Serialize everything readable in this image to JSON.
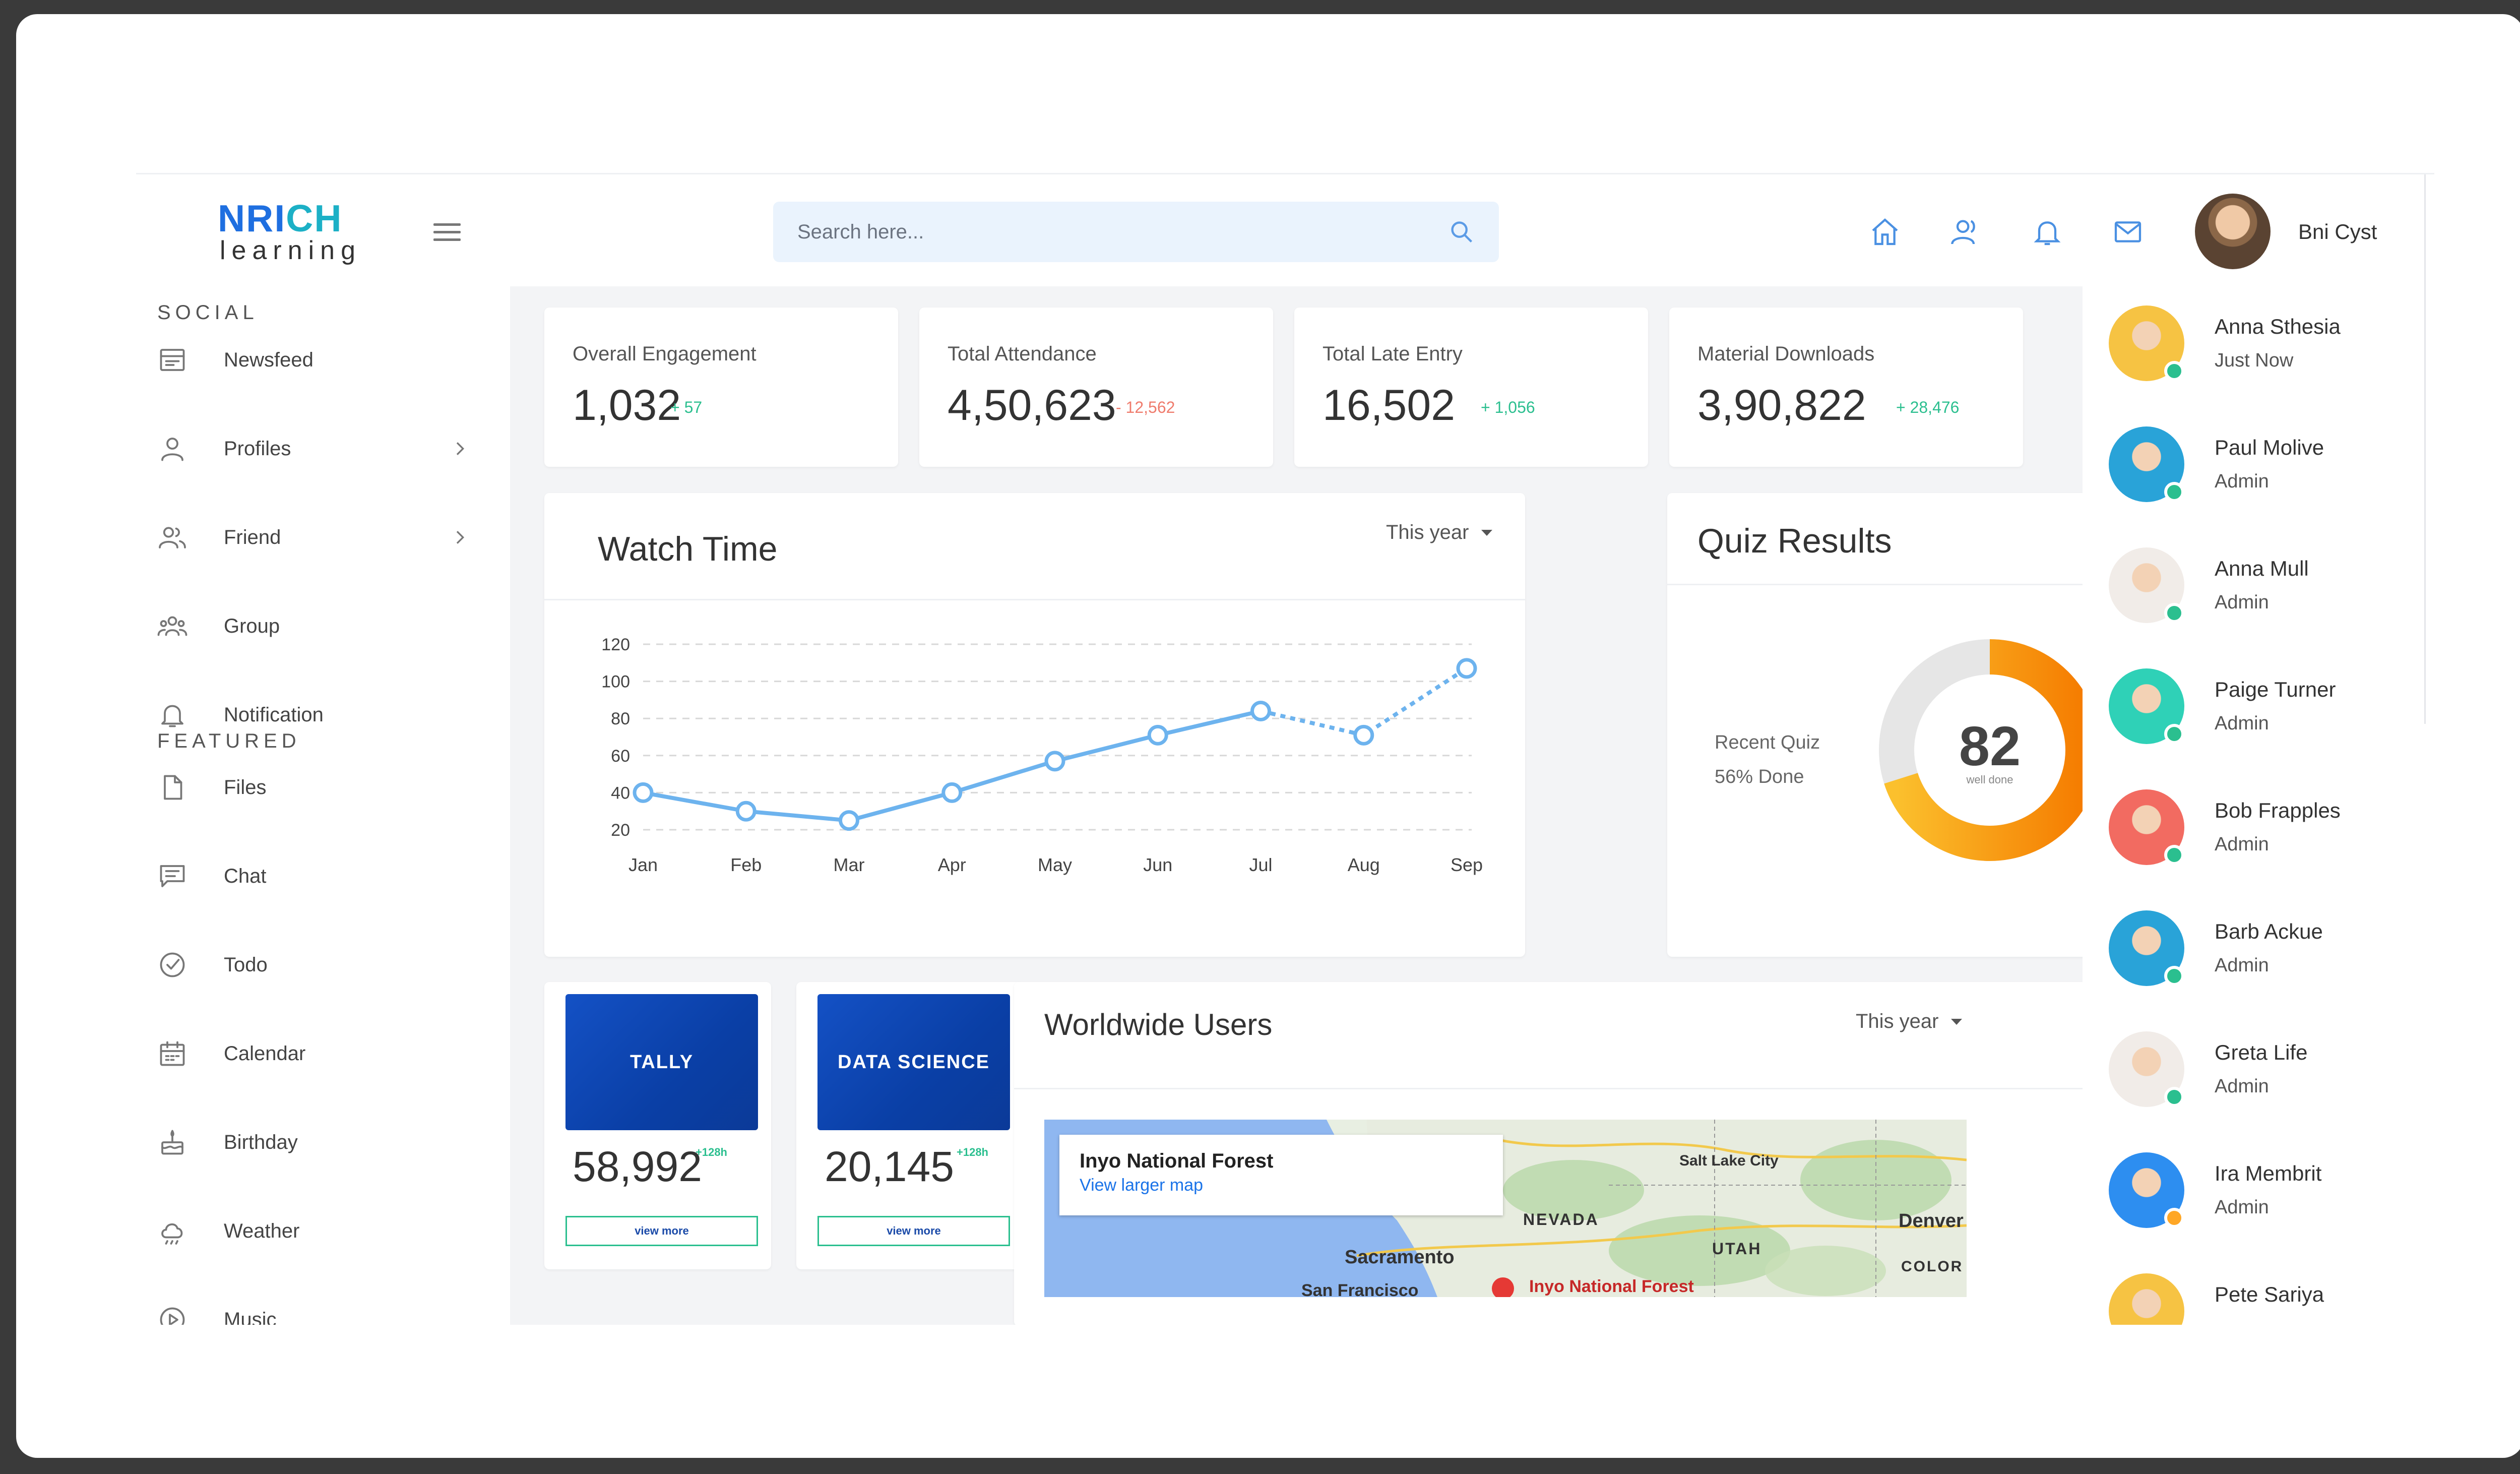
{
  "app": {
    "logo_main": "NRICH",
    "logo_sub": "learning"
  },
  "header": {
    "search_placeholder": "Search here...",
    "user_name": "Bni Cyst",
    "icons": [
      "home-icon",
      "users-icon",
      "bell-icon",
      "mail-icon"
    ]
  },
  "sidebar": {
    "social_title": "SOCIAL",
    "featured_title": "FEATURED",
    "social_items": [
      {
        "label": "Newsfeed",
        "icon": "newsfeed-icon",
        "chevron": false
      },
      {
        "label": "Profiles",
        "icon": "profile-icon",
        "chevron": true
      },
      {
        "label": "Friend",
        "icon": "friend-icon",
        "chevron": true
      },
      {
        "label": "Group",
        "icon": "group-icon",
        "chevron": false
      },
      {
        "label": "Notification",
        "icon": "notification-icon",
        "chevron": false
      }
    ],
    "featured_items": [
      {
        "label": "Files",
        "icon": "file-icon"
      },
      {
        "label": "Chat",
        "icon": "chat-icon"
      },
      {
        "label": "Todo",
        "icon": "todo-icon"
      },
      {
        "label": "Calendar",
        "icon": "calendar-icon"
      },
      {
        "label": "Birthday",
        "icon": "birthday-icon"
      },
      {
        "label": "Weather",
        "icon": "weather-icon"
      },
      {
        "label": "Music",
        "icon": "music-icon"
      }
    ]
  },
  "stats": [
    {
      "label": "Overall Engagement",
      "value": "1,032",
      "delta": "+ 57",
      "trend": "up"
    },
    {
      "label": "Total Attendance",
      "value": "4,50,623",
      "delta": "- 12,562",
      "trend": "down"
    },
    {
      "label": "Total Late Entry",
      "value": "16,502",
      "delta": "+ 1,056",
      "trend": "up"
    },
    {
      "label": "Material Downloads",
      "value": "3,90,822",
      "delta": "+ 28,476",
      "trend": "up"
    }
  ],
  "watch_time": {
    "title": "Watch Time",
    "period": "This year"
  },
  "chart_data": {
    "type": "line",
    "categories": [
      "Jan",
      "Feb",
      "Mar",
      "Apr",
      "May",
      "Jun",
      "Jul",
      "Aug",
      "Sep"
    ],
    "values": [
      40,
      30,
      25,
      40,
      57,
      71,
      84,
      71,
      107
    ],
    "dashed_from_index": 6,
    "y_ticks": [
      120,
      100,
      80,
      60,
      40,
      20
    ],
    "ylim": [
      20,
      120
    ],
    "grid": "dashed-horizontal",
    "color": "#6db3ee"
  },
  "quiz": {
    "title": "Quiz Results",
    "caption_1": "Recent Quiz",
    "caption_2": "56% Done",
    "score": "82",
    "score_sub": "well done",
    "done_fraction": 0.56
  },
  "courses": [
    {
      "name": "TALLY",
      "count": "58,992",
      "plus": "+128h",
      "button": "view more"
    },
    {
      "name": "DATA SCIENCE",
      "count": "20,145",
      "plus": "+128h",
      "button": "view more"
    }
  ],
  "worldwide": {
    "title": "Worldwide Users",
    "period": "This year",
    "map_place": "Inyo National Forest",
    "map_link": "View larger map",
    "map_labels": [
      "Salt Lake City",
      "NEVADA",
      "Denver",
      "UTAH",
      "Sacramento",
      "COLOR",
      "San Francisco",
      "Inyo National Forest"
    ]
  },
  "contacts": [
    {
      "name": "Anna Sthesia",
      "role": "Just Now",
      "status": "online",
      "avatar_color": "#f6c343"
    },
    {
      "name": "Paul Molive",
      "role": "Admin",
      "status": "online",
      "avatar_color": "#29a3d8"
    },
    {
      "name": "Anna Mull",
      "role": "Admin",
      "status": "online",
      "avatar_color": "#f1ece8"
    },
    {
      "name": "Paige Turner",
      "role": "Admin",
      "status": "online",
      "avatar_color": "#2fd1b7"
    },
    {
      "name": "Bob Frapples",
      "role": "Admin",
      "status": "online",
      "avatar_color": "#f26b61"
    },
    {
      "name": "Barb Ackue",
      "role": "Admin",
      "status": "online",
      "avatar_color": "#29a3d8"
    },
    {
      "name": "Greta Life",
      "role": "Admin",
      "status": "online",
      "avatar_color": "#f1ece8"
    },
    {
      "name": "Ira Membrit",
      "role": "Admin",
      "status": "away",
      "avatar_color": "#2d8ef0"
    },
    {
      "name": "Pete Sariya",
      "role": "",
      "status": "online",
      "avatar_color": "#f6c343"
    }
  ],
  "colors": {
    "accent": "#1f6fe0",
    "positive": "#2bbf8f",
    "negative": "#ef7b6c",
    "donut_start": "#fbc02d",
    "donut_end": "#f57c00",
    "donut_track": "#e6e6e6"
  }
}
